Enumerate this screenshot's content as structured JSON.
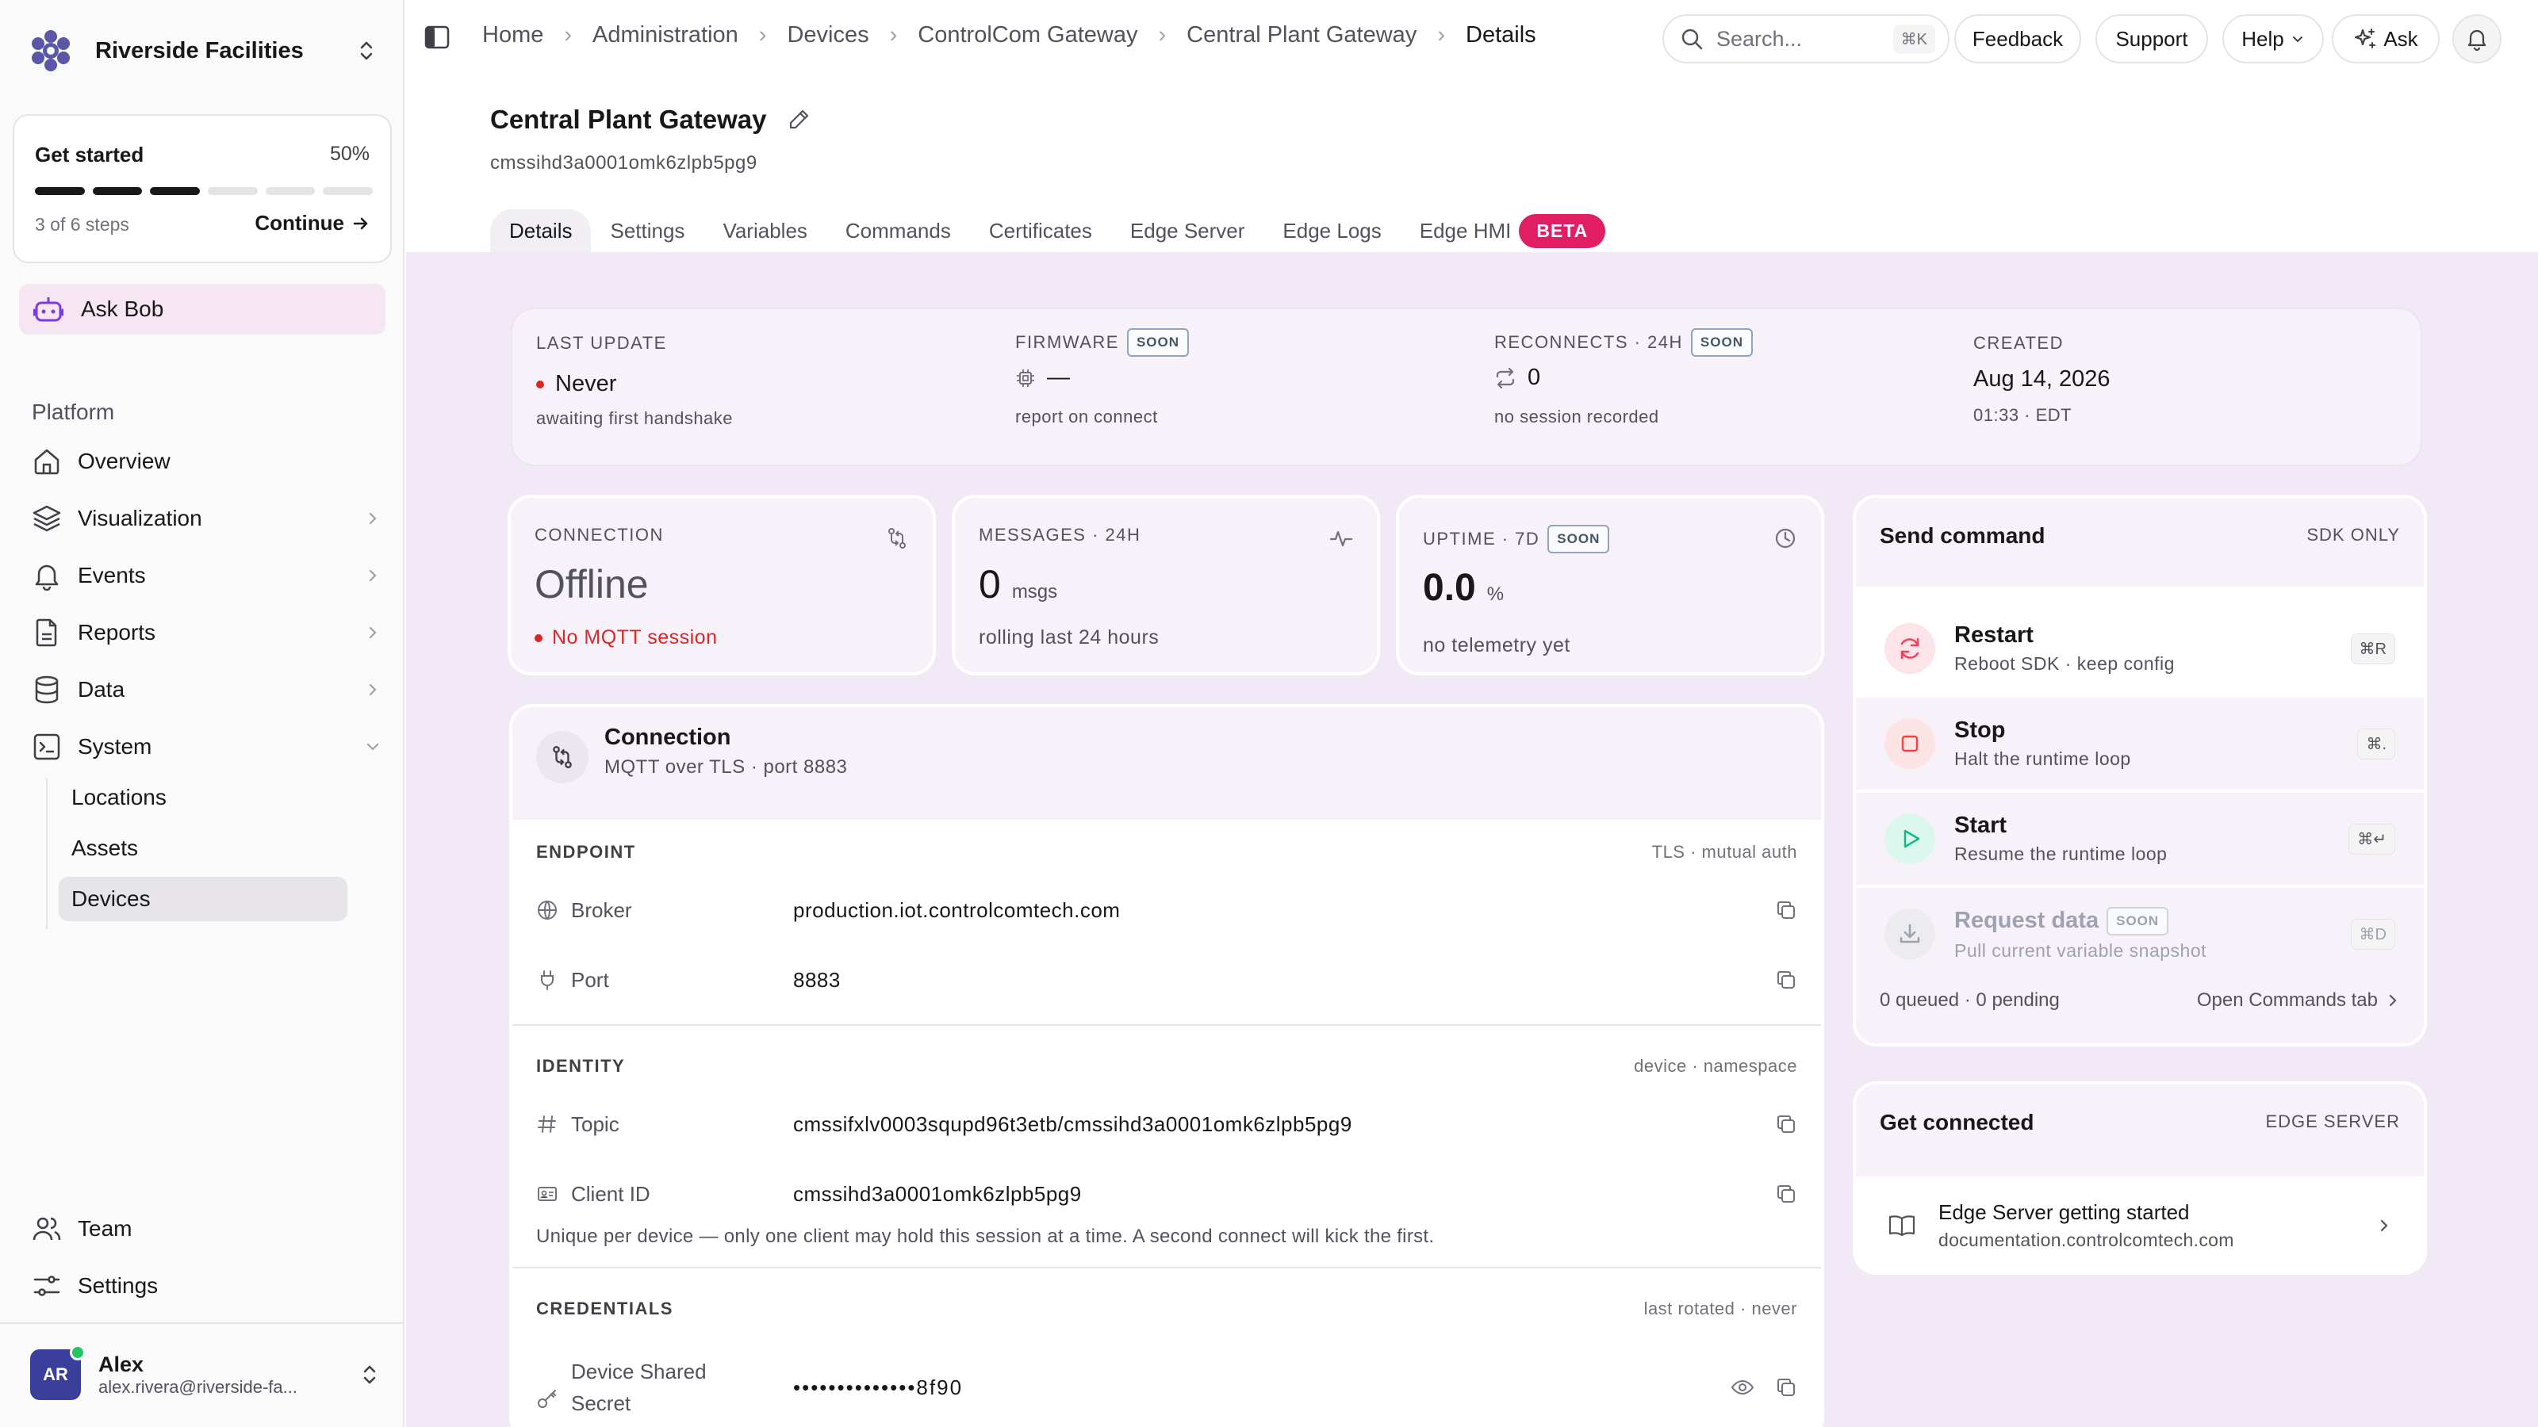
{
  "org": {
    "name": "Riverside Facilities"
  },
  "get_started": {
    "title": "Get started",
    "percent": "50%",
    "progress": 0.5,
    "steps": "3 of 6 steps",
    "continue": "Continue"
  },
  "ask_bob": "Ask Bob",
  "sidebar": {
    "section": "Platform",
    "items": [
      {
        "label": "Overview",
        "icon": "home-icon"
      },
      {
        "label": "Visualization",
        "icon": "layers-icon"
      },
      {
        "label": "Events",
        "icon": "bell-icon"
      },
      {
        "label": "Reports",
        "icon": "report-icon"
      },
      {
        "label": "Data",
        "icon": "database-icon"
      },
      {
        "label": "System",
        "icon": "terminal-icon"
      }
    ],
    "system_children": [
      "Locations",
      "Assets",
      "Devices"
    ],
    "team": "Team",
    "settings": "Settings"
  },
  "user": {
    "initials": "AR",
    "name": "Alex",
    "email": "alex.rivera@riverside-fa..."
  },
  "breadcrumbs": [
    "Home",
    "Administration",
    "Devices",
    "ControlCom Gateway",
    "Central Plant Gateway",
    "Details"
  ],
  "topbar": {
    "search_placeholder": "Search...",
    "search_shortcut": "⌘K",
    "feedback": "Feedback",
    "support": "Support",
    "help": "Help",
    "ask": "Ask"
  },
  "device": {
    "title": "Central Plant Gateway",
    "id": "cmssihd3a0001omk6zlpb5pg9"
  },
  "tabs": [
    "Details",
    "Settings",
    "Variables",
    "Commands",
    "Certificates",
    "Edge Server",
    "Edge Logs",
    "Edge HMI"
  ],
  "tab_badge": "BETA",
  "stats": {
    "last_update": {
      "label": "LAST UPDATE",
      "value": "Never",
      "sub": "awaiting first handshake"
    },
    "firmware": {
      "label": "FIRMWARE",
      "badge": "SOON",
      "value": "—",
      "sub": "report on connect"
    },
    "reconnects": {
      "label": "RECONNECTS · 24H",
      "badge": "SOON",
      "value": "0",
      "sub": "no session recorded"
    },
    "created": {
      "label": "CREATED",
      "value": "Aug 14, 2026",
      "sub": "01:33 · EDT"
    }
  },
  "kpis": {
    "connection": {
      "label": "CONNECTION",
      "value": "Offline",
      "sub": "No MQTT session"
    },
    "messages": {
      "label": "MESSAGES · 24H",
      "value": "0",
      "unit": "msgs",
      "sub": "rolling last 24 hours"
    },
    "uptime": {
      "label": "UPTIME · 7D",
      "badge": "SOON",
      "value": "0.0",
      "unit": "%",
      "sub": "no telemetry yet"
    }
  },
  "connection": {
    "title": "Connection",
    "subtitle": "MQTT over TLS · port 8883",
    "endpoint": {
      "label": "ENDPOINT",
      "right": "TLS · mutual auth",
      "broker_key": "Broker",
      "broker": "production.iot.controlcomtech.com",
      "port_key": "Port",
      "port": "8883"
    },
    "identity": {
      "label": "IDENTITY",
      "right": "device · namespace",
      "topic_key": "Topic",
      "topic": "cmssifxlv0003squpd96t3etb/cmssihd3a0001omk6zlpb5pg9",
      "client_key": "Client ID",
      "client": "cmssihd3a0001omk6zlpb5pg9",
      "note": "Unique per device — only one client may hold this session at a time. A second connect will kick the first."
    },
    "credentials": {
      "label": "CREDENTIALS",
      "right": "last rotated · never",
      "secret_key_1": "Device Shared",
      "secret_key_2": "Secret",
      "secret": "••••••••••••••8f90"
    }
  },
  "send_command": {
    "title": "Send command",
    "right": "SDK ONLY",
    "items": [
      {
        "name": "Restart",
        "desc": "Reboot SDK · keep config",
        "key": "⌘R",
        "color": "#f43f5e"
      },
      {
        "name": "Stop",
        "desc": "Halt the runtime loop",
        "key": "⌘.",
        "color": "#ef4444"
      },
      {
        "name": "Start",
        "desc": "Resume the runtime loop",
        "key": "⌘↵",
        "color": "#10b981"
      },
      {
        "name": "Request data",
        "desc": "Pull current variable snapshot",
        "key": "⌘D",
        "badge": "SOON"
      }
    ],
    "queue": "0 queued · 0 pending",
    "open_tab": "Open Commands tab"
  },
  "get_connected": {
    "title": "Get connected",
    "right": "EDGE SERVER",
    "link_title": "Edge Server getting started",
    "link_url": "documentation.controlcomtech.com"
  }
}
